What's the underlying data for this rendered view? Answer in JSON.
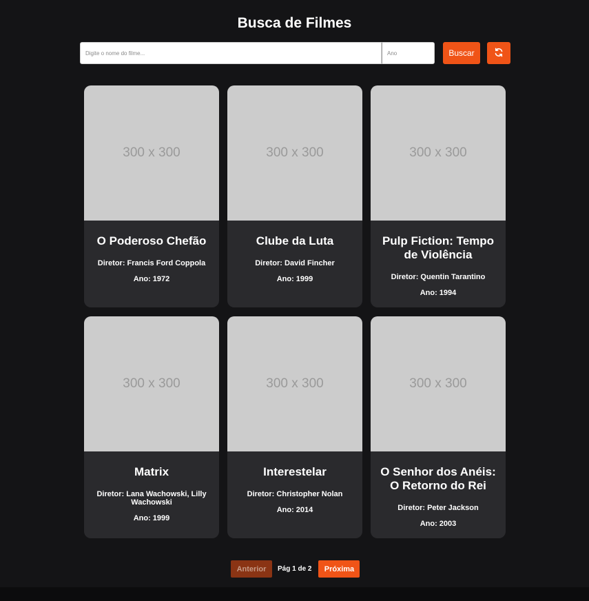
{
  "header": {
    "title": "Busca de Filmes"
  },
  "search": {
    "query_placeholder": "Digite o nome do filme...",
    "query_value": "",
    "year_placeholder": "Ano",
    "year_value": "",
    "search_label": "Buscar",
    "refresh_icon": "refresh-icon"
  },
  "colors": {
    "accent": "#f05417",
    "background": "#141416",
    "card": "#2a2a2d",
    "placeholder_image": "#cccccc"
  },
  "movies": [
    {
      "poster": "300 x 300",
      "title": "O Poderoso Chefão",
      "director": "Diretor: Francis Ford Coppola",
      "year": "Ano: 1972"
    },
    {
      "poster": "300 x 300",
      "title": "Clube da Luta",
      "director": "Diretor: David Fincher",
      "year": "Ano: 1999"
    },
    {
      "poster": "300 x 300",
      "title": "Pulp Fiction: Tempo de Violência",
      "director": "Diretor: Quentin Tarantino",
      "year": "Ano: 1994"
    },
    {
      "poster": "300 x 300",
      "title": "Matrix",
      "director": "Diretor: Lana Wachowski, Lilly Wachowski",
      "year": "Ano: 1999"
    },
    {
      "poster": "300 x 300",
      "title": "Interestelar",
      "director": "Diretor: Christopher Nolan",
      "year": "Ano: 2014"
    },
    {
      "poster": "300 x 300",
      "title": "O Senhor dos Anéis: O Retorno do Rei",
      "director": "Diretor: Peter Jackson",
      "year": "Ano: 2003"
    }
  ],
  "pagination": {
    "prev_label": "Anterior",
    "page_text": "Pág 1 de 2",
    "next_label": "Próxima"
  }
}
